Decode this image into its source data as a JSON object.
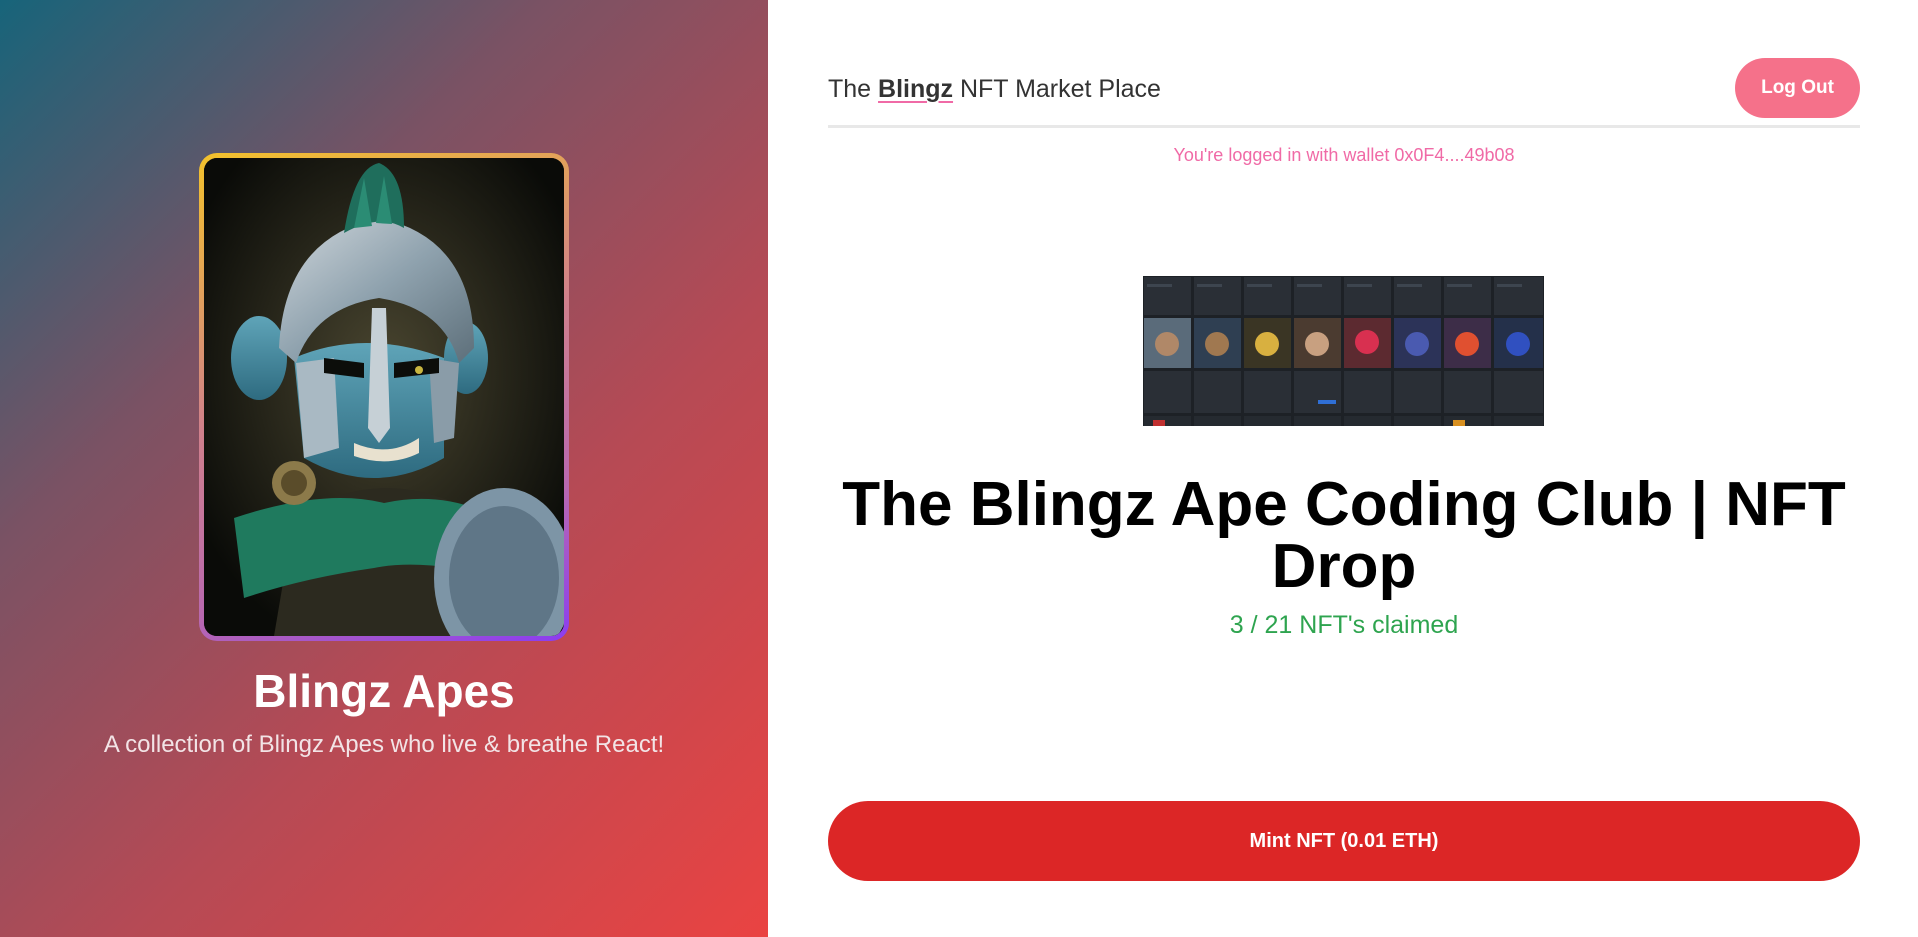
{
  "collection": {
    "title": "Blingz Apes",
    "description": "A collection of Blingz Apes who live & breathe React!",
    "image_alt": "ape-warrior-helmet-nft"
  },
  "header": {
    "brand_prefix": "The ",
    "brand_highlight": "Blingz",
    "brand_suffix": " NFT Market Place",
    "logout_label": "Log Out"
  },
  "wallet_status": "You're logged in with wallet 0x0F4....49b08",
  "drop": {
    "title": "The Blingz Ape Coding Club | NFT Drop",
    "claimed": "3 / 21 NFT's claimed",
    "mint_label": "Mint NFT (0.01 ETH)"
  },
  "colors": {
    "accent_pink": "#f06aa6",
    "logout_bg": "#f5718a",
    "mint_bg": "#dc2626",
    "claimed_green": "#2ea44f"
  }
}
